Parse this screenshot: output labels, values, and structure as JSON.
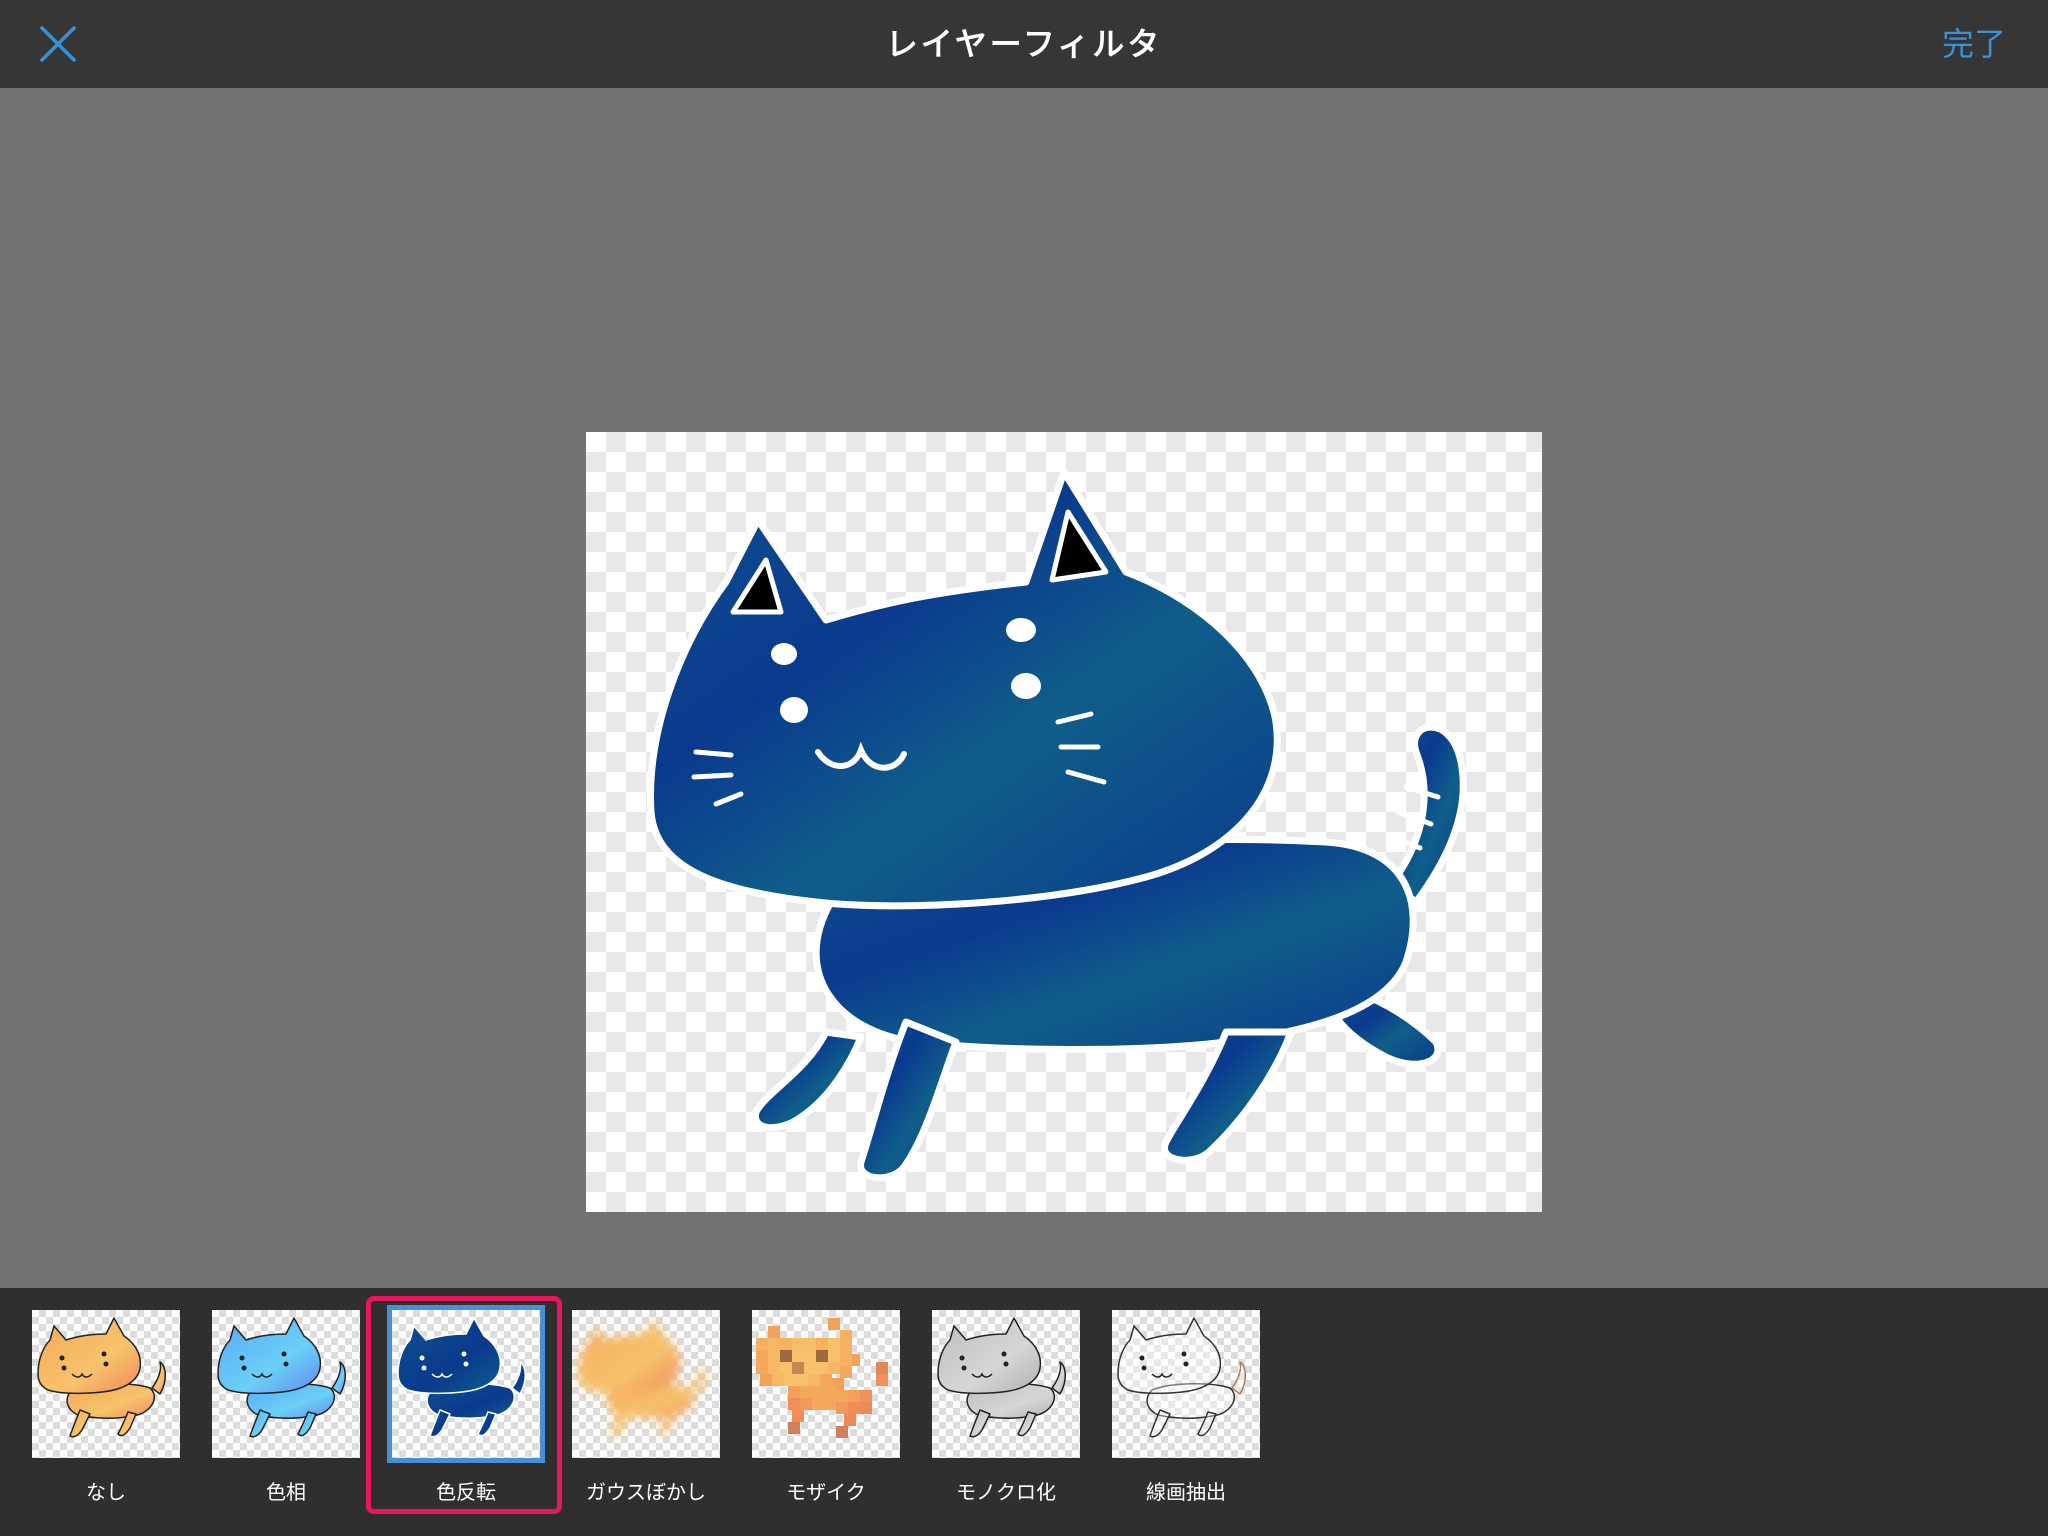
{
  "header": {
    "title": "レイヤーフィルタ",
    "done_label": "完了",
    "close_icon": "close-icon"
  },
  "colors": {
    "accent": "#3a92d6",
    "highlight": "#e8175d",
    "topbar": "#363636",
    "stage": "#727272",
    "filterbar": "#2f2f2f"
  },
  "filters": {
    "selected": "色反転",
    "items": [
      {
        "label": "なし"
      },
      {
        "label": "色相"
      },
      {
        "label": "色反転"
      },
      {
        "label": "ガウスぼかし"
      },
      {
        "label": "モザイク"
      },
      {
        "label": "モノクロ化"
      },
      {
        "label": "線画抽出"
      }
    ]
  }
}
